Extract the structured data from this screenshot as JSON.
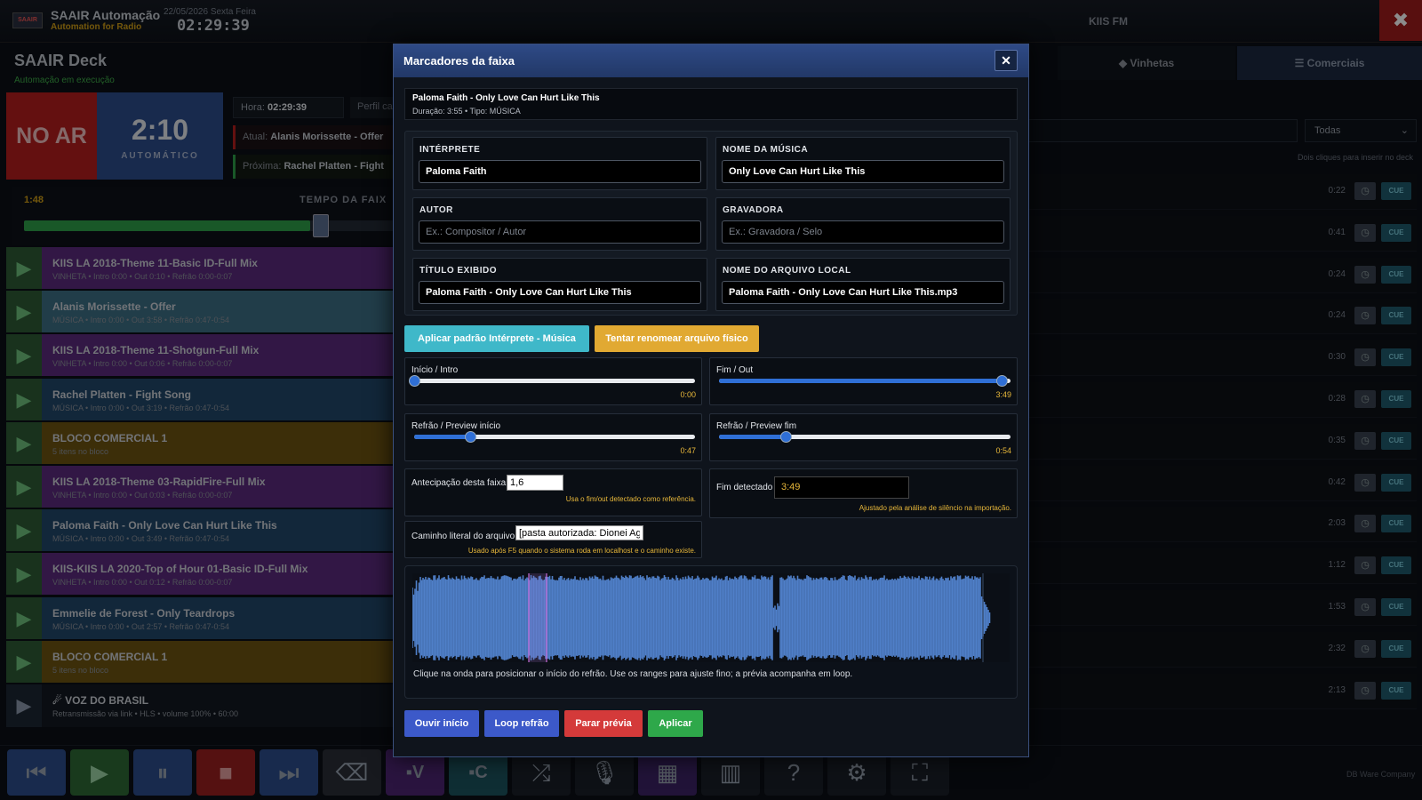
{
  "app": {
    "name": "SAAIR Automação",
    "subtitle": "Automation for Radio",
    "date": "22/05/2026 Sexta Feira",
    "clock": "02:29:39",
    "station": "KIIS FM",
    "logo_text": "SAAIR"
  },
  "deck": {
    "title": "SAAIR Deck",
    "status": "Automação em execução",
    "onair": "NO AR",
    "countdown": "2:10",
    "mode": "AUTOMÁTICO",
    "hora_label": "Hora:",
    "hora": "02:29:39",
    "perfil": "Perfil ca",
    "atual_label": "Atual:",
    "atual": "Alanis Morissette - Offer",
    "proxima_label": "Próxima:",
    "proxima": "Rachel Platten - Fight",
    "elapsed": "1:48",
    "tempo_label": "TEMPO DA FAIX",
    "progress": 0.78
  },
  "playlist": [
    {
      "title": "KIIS LA 2018-Theme 11-Basic ID-Full Mix",
      "sub": "VINHETA • Intro 0:00 • Out 0:10 • Refrão 0:00-0:07",
      "color": "#5b2a7e"
    },
    {
      "title": "Alanis Morissette - Offer",
      "sub": "MÚSICA • Intro 0:00 • Out 3:58 • Refrão 0:47-0:54",
      "color": "#3d6f86"
    },
    {
      "title": "KIIS LA 2018-Theme 11-Shotgun-Full Mix",
      "sub": "VINHETA • Intro 0:00 • Out 0:06 • Refrão 0:00-0:07",
      "color": "#5b2a7e"
    },
    {
      "title": "Rachel Platten - Fight Song",
      "sub": "MÚSICA • Intro 0:00 • Out 3:19 • Refrão 0:47-0:54",
      "color": "#21486b"
    },
    {
      "title": "BLOCO COMERCIAL 1",
      "sub": "5 itens no bloco",
      "color": "#6d5512"
    },
    {
      "title": "KIIS LA 2018-Theme 03-RapidFire-Full Mix",
      "sub": "VINHETA • Intro 0:00 • Out 0:03 • Refrão 0:00-0:07",
      "color": "#5b2a7e"
    },
    {
      "title": "Paloma Faith - Only Love Can Hurt Like This",
      "sub": "MÚSICA • Intro 0:00 • Out 3:49 • Refrão 0:47-0:54",
      "color": "#21486b"
    },
    {
      "title": "KIIS-KIIS LA 2020-Top of Hour 01-Basic ID-Full Mix",
      "sub": "VINHETA • Intro 0:00 • Out 0:12 • Refrão 0:00-0:07",
      "color": "#5b2a7e"
    },
    {
      "title": "Emmelie de Forest - Only Teardrops",
      "sub": "MÚSICA • Intro 0:00 • Out 2:57 • Refrão 0:47-0:54",
      "color": "#21486b"
    },
    {
      "title": "BLOCO COMERCIAL 1",
      "sub": "5 itens no bloco",
      "color": "#6d5512"
    }
  ],
  "voz": {
    "title": "VOZ DO BRASIL",
    "sub": "Retransmissão via link • HLS • volume 100% • 60:00"
  },
  "right": {
    "tab_vinhetas": "◆ Vinhetas",
    "tab_comerciais": "☰ Comerciais",
    "filter": "Todas",
    "hint": "Dois cliques para inserir no deck",
    "cue": "CUE",
    "durations": [
      "0:22",
      "0:41",
      "0:24",
      "0:24",
      "0:30",
      "0:28",
      "0:35",
      "0:42",
      "2:03",
      "1:12",
      "1:53",
      "2:32",
      "2:13"
    ]
  },
  "footer": {
    "company": "DB Ware Company"
  },
  "toolbar_icons": [
    "prev-icon",
    "play-icon",
    "pause-icon",
    "stop-icon",
    "next-icon",
    "eraser-icon",
    "vinheta-icon",
    "comercial-icon",
    "shuffle-icon",
    "mic-icon",
    "grid-icon",
    "building-icon",
    "help-icon",
    "gear-icon",
    "fullscreen-icon"
  ],
  "modal": {
    "title": "Marcadores da faixa",
    "close": "✕",
    "track_name": "Paloma Faith - Only Love Can Hurt Like This",
    "track_meta": "Duração: 3:55 • Tipo: MÚSICA",
    "fields": {
      "interprete_label": "INTÉRPRETE",
      "interprete": "Paloma Faith",
      "musica_label": "NOME DA MÚSICA",
      "musica": "Only Love Can Hurt Like This",
      "autor_label": "AUTOR",
      "autor_placeholder": "Ex.: Compositor / Autor",
      "gravadora_label": "GRAVADORA",
      "gravadora_placeholder": "Ex.: Gravadora / Selo",
      "titulo_label": "TÍTULO EXIBIDO",
      "titulo": "Paloma Faith - Only Love Can Hurt Like This",
      "arquivo_label": "NOME DO ARQUIVO LOCAL",
      "arquivo": "Paloma Faith - Only Love Can Hurt Like This.mp3"
    },
    "btn_aplicar_padrao": "Aplicar padrão Intérprete - Música",
    "btn_renomear": "Tentar renomear arquivo físico",
    "ranges": {
      "inicio_label": "Início / Intro",
      "inicio": "0:00",
      "inicio_pos": 0.0,
      "fim_label": "Fim / Out",
      "fim": "3:49",
      "fim_pos": 0.97,
      "refrao_ini_label": "Refrão / Preview início",
      "refrao_ini": "0:47",
      "refrao_ini_pos": 0.2,
      "refrao_fim_label": "Refrão / Preview fim",
      "refrao_fim": "0:54",
      "refrao_fim_pos": 0.23
    },
    "antecipacao_label": "Antecipação desta faixa",
    "antecipacao": "1,6",
    "antecipacao_note": "Usa o fim/out detectado como referência.",
    "fim_detectado_label": "Fim detectado",
    "fim_detectado": "3:49",
    "fim_detectado_note": "Ajustado pela análise de silêncio na importação.",
    "caminho_label": "Caminho literal do arquivo",
    "caminho": "[pasta autorizada: Dionei Agu",
    "caminho_note": "Usado após F5 quando o sistema roda em localhost e o caminho existe.",
    "wave_caption": "Clique na onda para posicionar o início do refrão. Use os ranges para ajuste fino; a prévia acompanha em loop.",
    "btn_ouvir": "Ouvir início",
    "btn_loop": "Loop refrão",
    "btn_parar": "Parar prévia",
    "btn_aplicar": "Aplicar"
  }
}
